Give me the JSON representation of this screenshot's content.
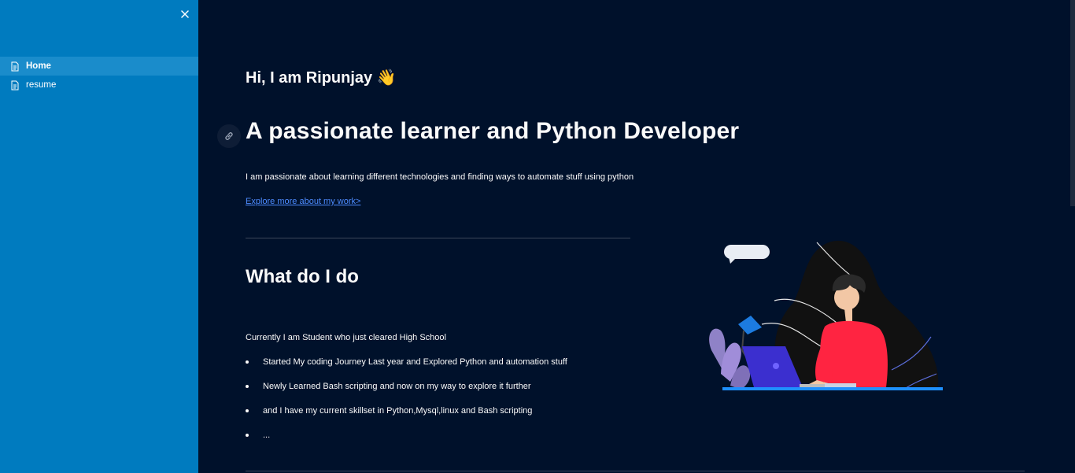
{
  "sidebar": {
    "close_icon": "close-icon",
    "items": [
      {
        "label": "Home",
        "icon": "document-icon",
        "active": true
      },
      {
        "label": "resume",
        "icon": "document-icon",
        "active": false
      }
    ]
  },
  "main": {
    "greeting": "Hi, I am Ripunjay 👋",
    "headline": "A passionate learner and Python Developer",
    "intro": "I am passionate about learning different technologies and finding ways to automate stuff using python",
    "explore_link": "Explore more about my work>",
    "section_title": "What do I do",
    "status": "Currently I am Student who just cleared High School",
    "bullets": [
      "Started My coding Journey Last year and Explored Python and automation stuff",
      "Newly Learned Bash scripting and now on my way to explore it further",
      "and I have my current skillset in Python,Mysql,linux and Bash scripting",
      "..."
    ]
  },
  "colors": {
    "sidebar_bg": "#007bbf",
    "sidebar_active": "#1a8ccb",
    "main_bg": "#00112b",
    "link": "#4d8cff",
    "shirt": "#ff2441"
  }
}
